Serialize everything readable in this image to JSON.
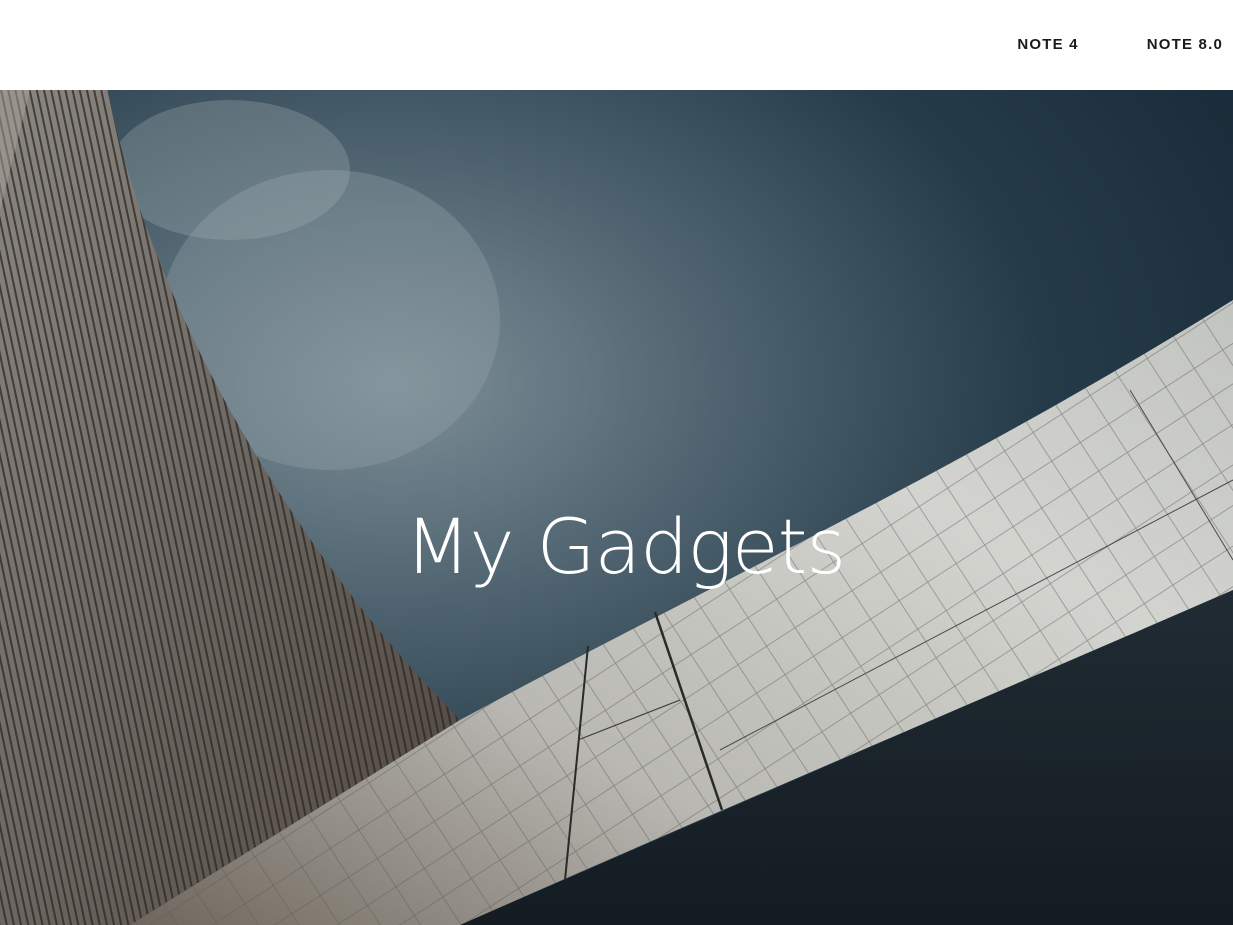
{
  "nav": {
    "items": [
      {
        "label": "NOTE 4"
      },
      {
        "label": "NOTE 8.0"
      }
    ]
  },
  "hero": {
    "title": "My Gadgets"
  },
  "colors": {
    "sky_dark": "#1d3140",
    "sky_light": "#8a9ba3",
    "panel_light": "#c9cac5",
    "panel_shadow": "#1a242b",
    "facade": "#6f6a64",
    "text_white": "#ffffff",
    "nav_text": "#1a1a1a"
  }
}
